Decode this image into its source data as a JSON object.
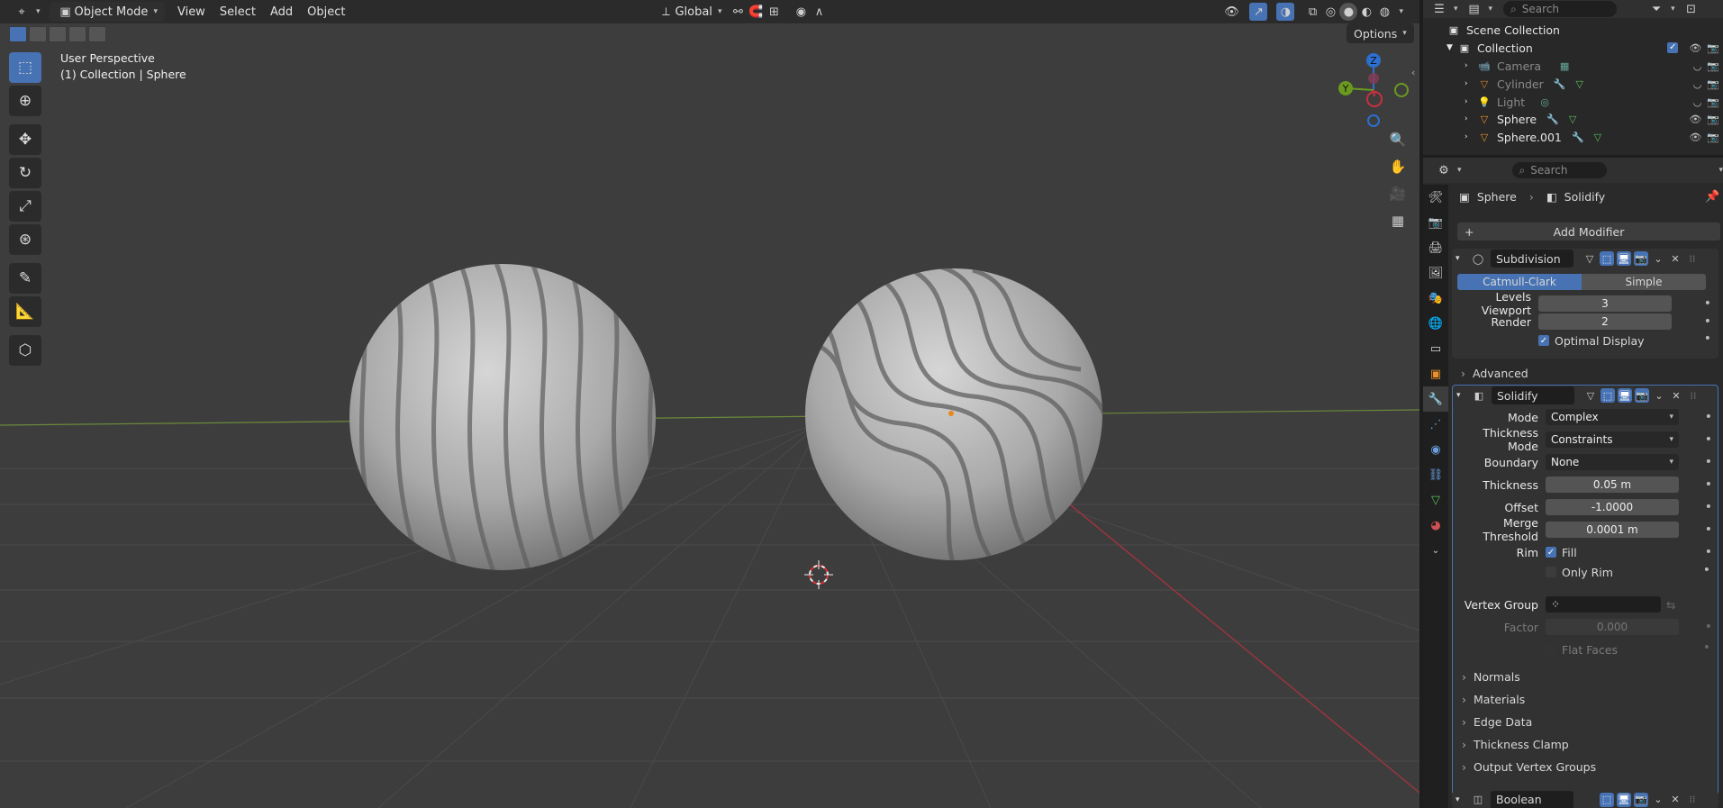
{
  "viewport": {
    "header": {
      "mode": "Object Mode",
      "menus": [
        "View",
        "Select",
        "Add",
        "Object"
      ],
      "transform_orientation": "Global"
    },
    "info_line1": "User Perspective",
    "info_line2": "(1) Collection | Sphere",
    "options_label": "Options",
    "gizmo": {
      "z": "Z",
      "y": "Y",
      "x_color": "#c8303e",
      "y_color": "#6a9a1f",
      "z_color": "#2c6fcf"
    }
  },
  "outliner": {
    "search_placeholder": "Search",
    "scene_collection": "Scene Collection",
    "collection": "Collection",
    "items": [
      {
        "label": "Camera",
        "icon": "camera-icon",
        "visible": false
      },
      {
        "label": "Cylinder",
        "icon": "mesh-icon",
        "visible": false
      },
      {
        "label": "Light",
        "icon": "light-icon",
        "visible": false
      },
      {
        "label": "Sphere",
        "icon": "mesh-icon",
        "visible": true
      },
      {
        "label": "Sphere.001",
        "icon": "mesh-icon",
        "visible": true
      }
    ]
  },
  "properties": {
    "search_placeholder": "Search",
    "breadcrumb_object": "Sphere",
    "breadcrumb_modifier": "Solidify",
    "add_modifier": "Add Modifier",
    "subdivision": {
      "name": "Subdivision",
      "tab_catmull": "Catmull-Clark",
      "tab_simple": "Simple",
      "levels_viewport_label": "Levels Viewport",
      "levels_viewport": "3",
      "render_label": "Render",
      "render": "2",
      "optimal_display": "Optimal Display",
      "advanced": "Advanced"
    },
    "solidify": {
      "name": "Solidify",
      "mode_label": "Mode",
      "mode": "Complex",
      "thickness_mode_label": "Thickness Mode",
      "thickness_mode": "Constraints",
      "boundary_label": "Boundary",
      "boundary": "None",
      "thickness_label": "Thickness",
      "thickness": "0.05 m",
      "offset_label": "Offset",
      "offset": "-1.0000",
      "merge_label": "Merge Threshold",
      "merge": "0.0001 m",
      "rim_label": "Rim",
      "fill": "Fill",
      "only_rim": "Only Rim",
      "vertex_group_label": "Vertex Group",
      "factor_label": "Factor",
      "factor": "0.000",
      "flat_faces": "Flat Faces",
      "sections": [
        "Normals",
        "Materials",
        "Edge Data",
        "Thickness Clamp",
        "Output Vertex Groups"
      ]
    },
    "boolean": {
      "name": "Boolean"
    }
  }
}
